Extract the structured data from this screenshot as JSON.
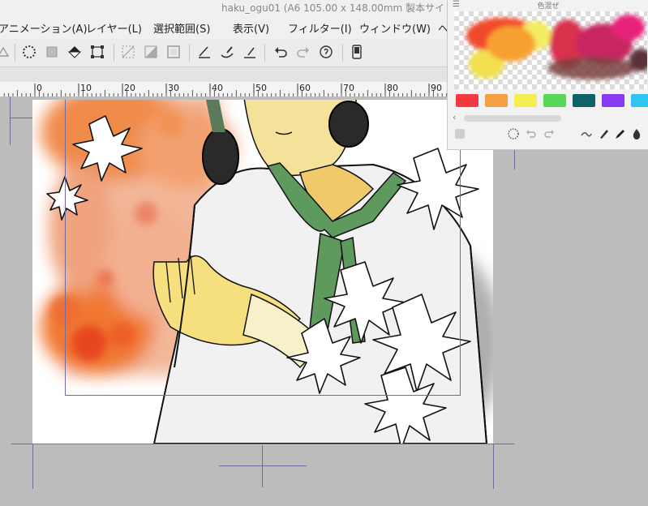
{
  "window": {
    "title": "haku_ogu01 (A6 105.00 x 148.00mm 製本サイ"
  },
  "menu": {
    "items": [
      {
        "label": "アニメーション(A)"
      },
      {
        "label": "レイヤー(L)"
      },
      {
        "label": "選択範囲(S)"
      },
      {
        "label": "表示(V)"
      },
      {
        "label": "フィルター(I)"
      },
      {
        "label": "ウィンドウ(W)"
      },
      {
        "label": "ヘ"
      }
    ]
  },
  "ruler": {
    "labels": [
      "0",
      "10",
      "20",
      "30",
      "40",
      "50",
      "60",
      "70",
      "80",
      "90"
    ]
  },
  "color_mix_panel": {
    "title": "色混ぜ",
    "swatches": [
      "#f23a3f",
      "#f5a042",
      "#f4ee55",
      "#58d85a",
      "#0f6268",
      "#8a39f3",
      "#2fc4f2"
    ]
  },
  "colors": {
    "chrome": "#f0f0f0",
    "canvas_bg": "#bcbcbc",
    "guide": "#6d6da0"
  }
}
